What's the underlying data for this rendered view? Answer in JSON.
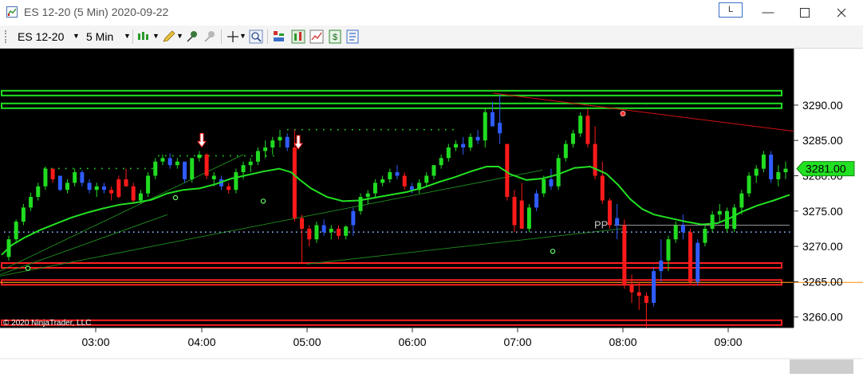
{
  "window": {
    "title": "ES 12-20 (5 Min)  2020-09-22",
    "link_button": "L",
    "minimize_icon": "minimize-icon",
    "maximize_icon": "maximize-icon",
    "close_icon": "close-icon"
  },
  "toolbar": {
    "instrument": "ES 12-20",
    "interval": "5 Min",
    "icons": [
      "bar-type-icon",
      "drawing-pencil-icon",
      "pin-icon",
      "pin-grey-icon",
      "crosshair-icon",
      "zoom-icon",
      "strategy-icon",
      "indicators-icon",
      "templates-icon",
      "dollar-icon",
      "properties-icon"
    ]
  },
  "chart_data": {
    "type": "candlestick",
    "instrument": "ES 12-20",
    "interval": "5 Min",
    "date": "2020-09-22",
    "x_ticks": [
      "03:00",
      "04:00",
      "05:00",
      "06:00",
      "07:00",
      "08:00",
      "09:00"
    ],
    "y_ticks": [
      3260.0,
      3265.0,
      3270.0,
      3275.0,
      3280.0,
      3285.0,
      3290.0
    ],
    "ylim": [
      3258.5,
      3298.0
    ],
    "last_price_label": "3281.00",
    "pivot_label": "PP",
    "pivot_level": 3273.0,
    "copyright": "© 2020 NinjaTrader, LLC",
    "colors": {
      "up": "#21dc21",
      "down": "#ff1a1a",
      "blue": "#2f5cff",
      "sma": "#22e022",
      "support_band": "#ff2020",
      "resistance_band": "#22e022",
      "trend": "#d01010",
      "pivot": "#c8c8c8"
    },
    "horizontal_bands": [
      {
        "price": 3291.7,
        "color": "green"
      },
      {
        "price": 3289.9,
        "color": "green"
      },
      {
        "price": 3267.3,
        "color": "red"
      },
      {
        "price": 3264.9,
        "color": "red"
      },
      {
        "price": 3259.2,
        "color": "red"
      }
    ],
    "candles": [
      [
        3268.5,
        3271.5,
        3268.0,
        3271.0,
        "up"
      ],
      [
        3271.0,
        3273.8,
        3270.5,
        3273.5,
        "up"
      ],
      [
        3273.5,
        3276.0,
        3273.0,
        3275.5,
        "up"
      ],
      [
        3275.5,
        3277.6,
        3275.0,
        3277.0,
        "up"
      ],
      [
        3277.0,
        3279.0,
        3276.5,
        3278.5,
        "up"
      ],
      [
        3278.5,
        3281.3,
        3278.0,
        3281.0,
        "up"
      ],
      [
        3281.0,
        3280.8,
        3279.0,
        3279.5,
        "down"
      ],
      [
        3280.0,
        3278.5,
        3277.8,
        3278.0,
        "blue"
      ],
      [
        3278.0,
        3279.5,
        3277.5,
        3279.0,
        "up"
      ],
      [
        3279.0,
        3281.0,
        3278.5,
        3280.5,
        "up"
      ],
      [
        3280.5,
        3280.8,
        3278.5,
        3279.0,
        "blue"
      ],
      [
        3279.0,
        3279.5,
        3277.5,
        3278.0,
        "blue"
      ],
      [
        3278.0,
        3279.0,
        3277.0,
        3278.5,
        "up"
      ],
      [
        3278.5,
        3279.0,
        3277.5,
        3278.0,
        "blue"
      ],
      [
        3278.0,
        3278.5,
        3276.5,
        3277.5,
        "down"
      ],
      [
        3277.0,
        3280.0,
        3276.8,
        3279.5,
        "down"
      ],
      [
        3279.5,
        3281.0,
        3278.5,
        3278.5,
        "down"
      ],
      [
        3278.5,
        3279.0,
        3276.0,
        3276.5,
        "down"
      ],
      [
        3276.5,
        3278.0,
        3276.0,
        3277.5,
        "up"
      ],
      [
        3277.5,
        3280.5,
        3277.0,
        3280.0,
        "up"
      ],
      [
        3280.0,
        3282.5,
        3279.5,
        3282.0,
        "up"
      ],
      [
        3282.0,
        3283.0,
        3281.5,
        3282.5,
        "up"
      ],
      [
        3282.5,
        3283.2,
        3281.0,
        3281.5,
        "blue"
      ],
      [
        3281.5,
        3282.5,
        3281.0,
        3282.0,
        "up"
      ],
      [
        3282.0,
        3282.0,
        3279.0,
        3279.5,
        "blue"
      ],
      [
        3279.5,
        3282.5,
        3279.0,
        3282.5,
        "up"
      ],
      [
        3282.5,
        3283.5,
        3282.0,
        3283.0,
        "up"
      ],
      [
        3283.0,
        3283.2,
        3279.5,
        3280.0,
        "down"
      ],
      [
        3280.0,
        3280.5,
        3278.5,
        3279.5,
        "up"
      ],
      [
        3279.5,
        3280.0,
        3278.0,
        3278.5,
        "blue"
      ],
      [
        3278.5,
        3279.0,
        3277.5,
        3278.0,
        "down"
      ],
      [
        3278.0,
        3281.0,
        3277.5,
        3280.5,
        "up"
      ],
      [
        3280.5,
        3282.0,
        3279.5,
        3281.5,
        "up"
      ],
      [
        3281.5,
        3282.5,
        3280.5,
        3282.0,
        "up"
      ],
      [
        3282.0,
        3284.0,
        3281.5,
        3283.5,
        "up"
      ],
      [
        3283.5,
        3285.0,
        3282.5,
        3284.0,
        "up"
      ],
      [
        3284.0,
        3285.5,
        3283.0,
        3285.0,
        "up"
      ],
      [
        3285.0,
        3286.5,
        3284.0,
        3285.5,
        "up"
      ],
      [
        3285.5,
        3286.0,
        3283.5,
        3284.0,
        "blue"
      ],
      [
        3284.0,
        3286.5,
        3273.5,
        3274.0,
        "down"
      ],
      [
        3274.0,
        3274.5,
        3267.5,
        3272.5,
        "down"
      ],
      [
        3272.5,
        3273.0,
        3270.0,
        3271.0,
        "down"
      ],
      [
        3271.0,
        3273.5,
        3270.5,
        3273.0,
        "up"
      ],
      [
        3273.0,
        3273.8,
        3271.5,
        3272.0,
        "blue"
      ],
      [
        3272.0,
        3273.0,
        3271.0,
        3272.5,
        "up"
      ],
      [
        3272.5,
        3273.0,
        3271.0,
        3271.5,
        "down"
      ],
      [
        3271.5,
        3273.0,
        3271.0,
        3272.8,
        "up"
      ],
      [
        3273.0,
        3275.5,
        3271.5,
        3275.0,
        "blue"
      ],
      [
        3275.0,
        3277.5,
        3274.5,
        3277.0,
        "up"
      ],
      [
        3277.0,
        3278.0,
        3276.0,
        3277.5,
        "up"
      ],
      [
        3277.5,
        3279.5,
        3277.0,
        3279.0,
        "up"
      ],
      [
        3279.0,
        3280.0,
        3278.5,
        3279.5,
        "up"
      ],
      [
        3279.5,
        3281.0,
        3279.0,
        3280.5,
        "up"
      ],
      [
        3280.5,
        3281.5,
        3279.5,
        3280.0,
        "blue"
      ],
      [
        3280.0,
        3280.5,
        3278.0,
        3278.5,
        "down"
      ],
      [
        3278.5,
        3279.0,
        3277.5,
        3278.0,
        "blue"
      ],
      [
        3278.0,
        3279.5,
        3277.5,
        3279.0,
        "up"
      ],
      [
        3279.0,
        3280.5,
        3278.5,
        3280.0,
        "up"
      ],
      [
        3280.0,
        3281.5,
        3279.5,
        3281.5,
        "up"
      ],
      [
        3281.5,
        3283.0,
        3281.0,
        3282.5,
        "up"
      ],
      [
        3282.5,
        3284.5,
        3282.0,
        3284.0,
        "up"
      ],
      [
        3284.0,
        3285.0,
        3283.5,
        3284.5,
        "up"
      ],
      [
        3284.5,
        3285.5,
        3283.0,
        3284.0,
        "blue"
      ],
      [
        3284.0,
        3286.0,
        3283.5,
        3285.5,
        "up"
      ],
      [
        3285.5,
        3286.5,
        3284.5,
        3285.0,
        "blue"
      ],
      [
        3285.0,
        3289.5,
        3284.0,
        3289.0,
        "up"
      ],
      [
        3289.0,
        3290.5,
        3287.5,
        3287.0,
        "blue"
      ],
      [
        3287.5,
        3291.5,
        3284.5,
        3286.0,
        "blue"
      ],
      [
        3284.5,
        3284.5,
        3276.5,
        3277.0,
        "down"
      ],
      [
        3277.0,
        3278.0,
        3272.0,
        3273.0,
        "down"
      ],
      [
        3276.5,
        3279.0,
        3272.5,
        3272.5,
        "down"
      ],
      [
        3272.5,
        3276.0,
        3272.0,
        3275.5,
        "up"
      ],
      [
        3275.5,
        3278.0,
        3275.0,
        3277.5,
        "blue"
      ],
      [
        3277.5,
        3280.0,
        3277.0,
        3279.5,
        "up"
      ],
      [
        3279.5,
        3281.0,
        3278.0,
        3278.5,
        "blue"
      ],
      [
        3278.5,
        3283.0,
        3278.0,
        3282.5,
        "up"
      ],
      [
        3282.5,
        3285.0,
        3282.0,
        3284.5,
        "up"
      ],
      [
        3284.5,
        3286.5,
        3284.0,
        3286.0,
        "up"
      ],
      [
        3286.0,
        3289.0,
        3285.5,
        3288.5,
        "up"
      ],
      [
        3288.5,
        3289.5,
        3284.0,
        3284.5,
        "down"
      ],
      [
        3284.5,
        3287.0,
        3279.5,
        3280.0,
        "down"
      ],
      [
        3280.0,
        3282.0,
        3276.0,
        3276.5,
        "down"
      ],
      [
        3276.5,
        3276.8,
        3272.5,
        3273.0,
        "down"
      ],
      [
        3274.0,
        3276.0,
        3271.0,
        3273.0,
        "blue"
      ],
      [
        3273.0,
        3273.8,
        3264.0,
        3264.5,
        "down"
      ],
      [
        3264.5,
        3266.0,
        3262.0,
        3263.5,
        "down"
      ],
      [
        3263.5,
        3265.0,
        3261.0,
        3263.0,
        "down"
      ],
      [
        3263.0,
        3263.5,
        3258.5,
        3262.0,
        "down"
      ],
      [
        3262.0,
        3267.0,
        3261.5,
        3266.5,
        "blue"
      ],
      [
        3266.5,
        3271.0,
        3265.0,
        3268.0,
        "blue"
      ],
      [
        3268.0,
        3271.5,
        3266.5,
        3271.0,
        "up"
      ],
      [
        3271.0,
        3273.5,
        3270.5,
        3273.0,
        "up"
      ],
      [
        3273.0,
        3274.5,
        3271.0,
        3272.0,
        "blue"
      ],
      [
        3272.0,
        3272.5,
        3264.5,
        3265.0,
        "down"
      ],
      [
        3265.0,
        3271.0,
        3264.5,
        3270.5,
        "blue"
      ],
      [
        3270.5,
        3273.0,
        3270.0,
        3272.5,
        "up"
      ],
      [
        3272.5,
        3275.0,
        3272.0,
        3274.5,
        "up"
      ],
      [
        3274.5,
        3276.0,
        3273.5,
        3275.0,
        "up"
      ],
      [
        3275.0,
        3275.5,
        3272.0,
        3272.5,
        "up"
      ],
      [
        3272.5,
        3276.0,
        3272.0,
        3275.5,
        "up"
      ],
      [
        3275.5,
        3278.0,
        3274.5,
        3277.5,
        "up"
      ],
      [
        3277.5,
        3280.5,
        3277.0,
        3280.0,
        "up"
      ],
      [
        3280.0,
        3281.5,
        3279.0,
        3281.0,
        "up"
      ],
      [
        3281.0,
        3283.5,
        3280.5,
        3283.0,
        "up"
      ],
      [
        3283.0,
        3283.5,
        3279.0,
        3279.5,
        "blue"
      ],
      [
        3279.5,
        3281.5,
        3278.5,
        3280.5,
        "up"
      ],
      [
        3280.5,
        3282.0,
        3279.5,
        3281.0,
        "up"
      ]
    ],
    "sma_points": [
      [
        2,
        3268.8
      ],
      [
        15,
        3270.2
      ],
      [
        30,
        3271.2
      ],
      [
        50,
        3272.3
      ],
      [
        70,
        3273.2
      ],
      [
        90,
        3274.1
      ],
      [
        110,
        3274.8
      ],
      [
        130,
        3275.4
      ],
      [
        150,
        3275.9
      ],
      [
        170,
        3276.2
      ],
      [
        190,
        3276.6
      ],
      [
        210,
        3277.5
      ],
      [
        230,
        3278.0
      ],
      [
        250,
        3278.2
      ],
      [
        270,
        3278.8
      ],
      [
        290,
        3279.6
      ],
      [
        310,
        3280.1
      ],
      [
        330,
        3280.6
      ],
      [
        350,
        3281.0
      ],
      [
        365,
        3280.5
      ],
      [
        375,
        3279.5
      ],
      [
        390,
        3278.2
      ],
      [
        410,
        3277.0
      ],
      [
        430,
        3276.4
      ],
      [
        450,
        3276.5
      ],
      [
        470,
        3276.9
      ],
      [
        490,
        3277.3
      ],
      [
        510,
        3277.7
      ],
      [
        530,
        3278.3
      ],
      [
        550,
        3279.1
      ],
      [
        570,
        3279.8
      ],
      [
        590,
        3280.6
      ],
      [
        610,
        3281.3
      ],
      [
        625,
        3281.3
      ],
      [
        640,
        3280.2
      ],
      [
        660,
        3279.4
      ],
      [
        680,
        3279.6
      ],
      [
        700,
        3280.2
      ],
      [
        720,
        3281.1
      ],
      [
        740,
        3281.3
      ],
      [
        760,
        3280.3
      ],
      [
        775,
        3278.7
      ],
      [
        790,
        3276.7
      ],
      [
        805,
        3275.3
      ],
      [
        820,
        3274.5
      ],
      [
        840,
        3274.0
      ],
      [
        860,
        3273.5
      ],
      [
        880,
        3273.1
      ],
      [
        900,
        3273.3
      ],
      [
        915,
        3274.0
      ],
      [
        930,
        3274.9
      ],
      [
        950,
        3275.8
      ],
      [
        970,
        3276.5
      ],
      [
        990,
        3277.3
      ]
    ],
    "sma_dots": [
      [
        35,
        3266.9
      ],
      [
        220,
        3276.9
      ],
      [
        330,
        3276.4
      ],
      [
        693,
        3269.3
      ]
    ],
    "trend_line_red": {
      "from": [
        618,
        3291.7
      ],
      "to": [
        995,
        3286.3
      ]
    },
    "red_dot": [
      781,
      3288.8
    ],
    "thin_green_lines": [
      {
        "from": [
          0,
          3266.5
        ],
        "to": [
          305,
          3283.0
        ]
      },
      {
        "from": [
          0,
          3266.0
        ],
        "to": [
          210,
          3274.5
        ]
      },
      {
        "from": [
          0,
          3265.8
        ],
        "to": [
          680,
          3280.8
        ]
      },
      {
        "from": [
          385,
          3267.5
        ],
        "to": [
          780,
          3272.5
        ]
      }
    ],
    "sell_arrows": [
      [
        253,
        3284.3
      ],
      [
        374,
        3284.0
      ]
    ],
    "dots_green_row": {
      "price": 3281.0,
      "from": 55,
      "to": 195
    },
    "dots_green_row2": {
      "price": 3282.8,
      "from": 198,
      "to": 350
    },
    "dots_green_row3": {
      "price": 3286.5,
      "from": 360,
      "to": 575
    },
    "dots_blue_row": {
      "price": 3272.0,
      "from": 5,
      "to": 990
    }
  }
}
